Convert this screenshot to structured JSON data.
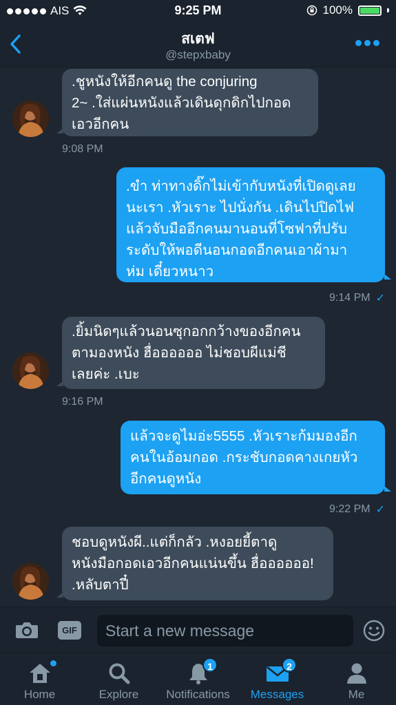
{
  "status_bar": {
    "carrier": "AIS",
    "time": "9:25 PM",
    "battery": "100%"
  },
  "header": {
    "title": "สเตฟ",
    "handle": "@stepxbaby"
  },
  "messages": [
    {
      "from": "them",
      "lines": [
        ".ชูหนังให้อีกคนดู the conjuring",
        "2~ .ใส่แผ่นหนังแล้วเดินดุกดิกไปกอด",
        "เอวอีกคน"
      ],
      "time": "9:08 PM"
    },
    {
      "from": "me",
      "lines": [
        ".ขำ ท่าทางดิ๊กไม่เข้ากับหนังที่เปิดดูเลย",
        "นะเรา .หัวเราะ ไปนั่งกัน .เดินไปปิดไฟ",
        "แล้วจับมืออีกคนมานอนที่โซฟาที่ปรับ",
        "ระดับให้พอดีนอนกอดอีกคนเอาผ้ามา",
        "ห่ม เดี๋ยวหนาว"
      ],
      "time": "9:14 PM"
    },
    {
      "from": "them",
      "lines": [
        ".ยิ้มนิดๆแล้วนอนซุกอกกว้างของอีกคน",
        "ตามองหนัง ฮื่ออออออ ไม่ชอบผีแม่ชี",
        "เลยค่ะ .เบะ"
      ],
      "time": "9:16 PM"
    },
    {
      "from": "me",
      "lines": [
        "แล้วจะดูไมอ่ะ5555 .หัวเราะก้มมองอีก",
        "คนในอ้อมกอด .กระชับกอดคางเกยหัว",
        "อีกคนดูหนัง"
      ],
      "time": "9:22 PM"
    },
    {
      "from": "them",
      "lines": [
        "ชอบดูหนังผี..แต่ก็กลัว .หงอยยี้ตาดู",
        "หนังมือกอดเอวอีกคนแน่นขึ้น ฮื่ออออออ!",
        ".หลับตาปี๋"
      ],
      "time": ""
    }
  ],
  "compose": {
    "placeholder": "Start a new message",
    "gif_label": "GIF"
  },
  "tabs": [
    {
      "label": "Home",
      "badge": ""
    },
    {
      "label": "Explore",
      "badge": ""
    },
    {
      "label": "Notifications",
      "badge": "1"
    },
    {
      "label": "Messages",
      "badge": "2"
    },
    {
      "label": "Me",
      "badge": ""
    }
  ],
  "colors": {
    "accent": "#1da1f2",
    "background": "#1e2632",
    "incoming_bubble": "#3d4b5a",
    "battery_fill": "#4cd964"
  }
}
